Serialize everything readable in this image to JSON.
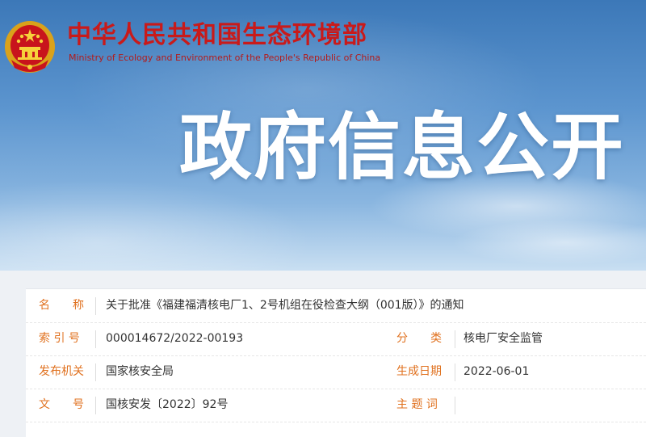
{
  "header": {
    "ministry_name_cn": "中华人民共和国生态环境部",
    "ministry_name_en": "Ministry of Ecology and Environment of the People's Republic of China",
    "page_heading": "政府信息公开",
    "emblem_icon": "national-emblem-icon"
  },
  "colors": {
    "brand_red": "#c91a1a",
    "label_orange": "#e0711f",
    "sky_blue": "#5c95cf"
  },
  "document_info": {
    "name": {
      "label": "名　　称",
      "value": "关于批准《福建福清核电厂1、2号机组在役检查大纲（001版）》的通知"
    },
    "index_no": {
      "label": "索 引 号",
      "value": "000014672/2022-00193"
    },
    "category": {
      "label": "分　　类",
      "value": "核电厂安全监管"
    },
    "issuer": {
      "label": "发布机关",
      "value": "国家核安全局"
    },
    "date": {
      "label": "生成日期",
      "value": "2022-06-01"
    },
    "doc_no": {
      "label": "文　　号",
      "value": "国核安发〔2022〕92号"
    },
    "subject": {
      "label": "主 题 词",
      "value": ""
    }
  }
}
